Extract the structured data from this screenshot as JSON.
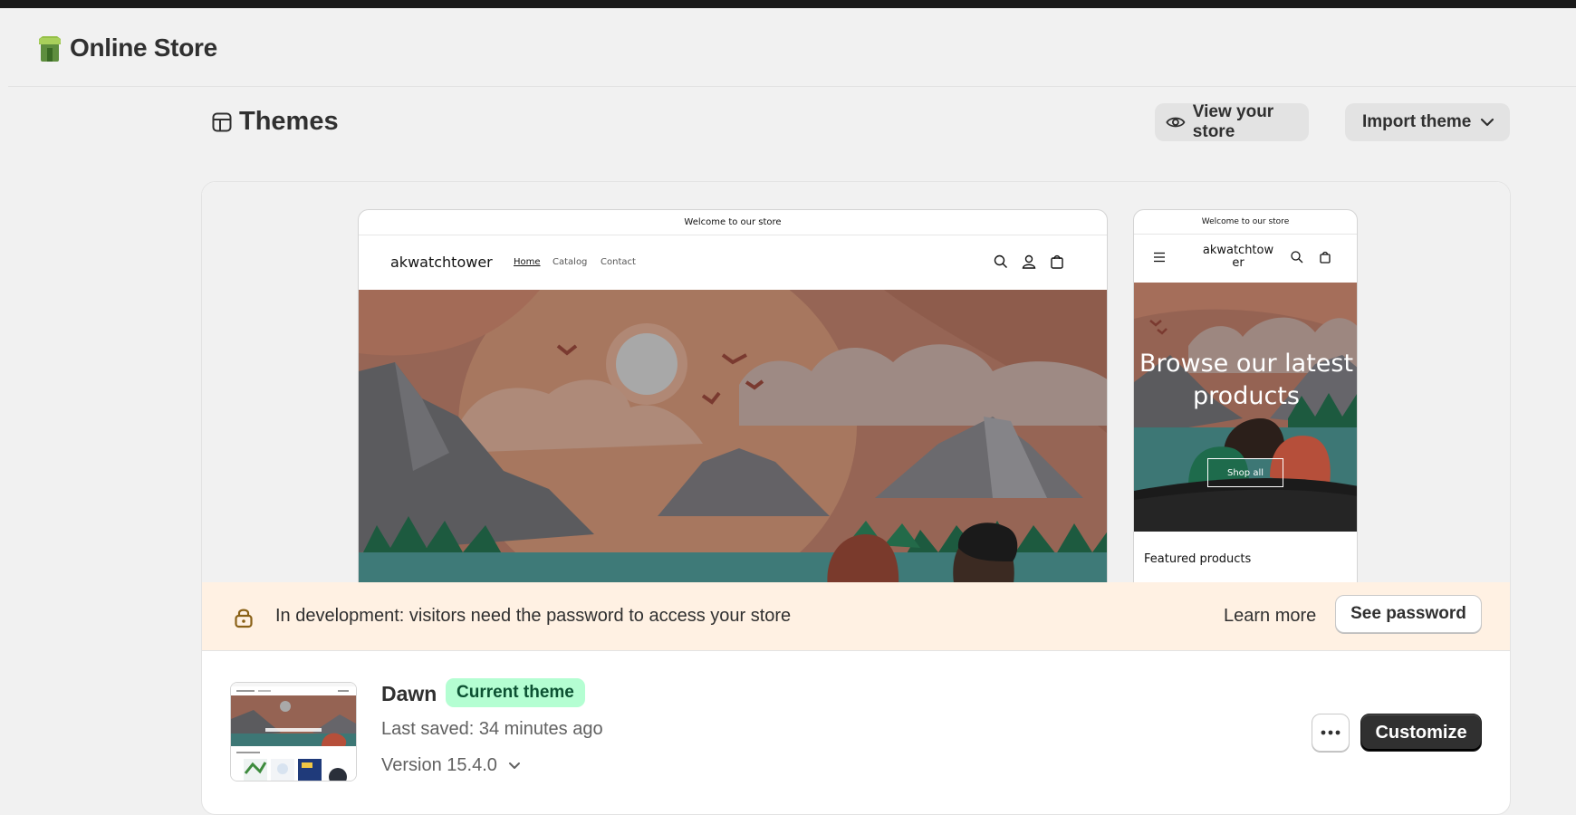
{
  "app": {
    "title": "Online Store"
  },
  "page": {
    "title": "Themes",
    "view_store_label": "View your store",
    "import_theme_label": "Import theme"
  },
  "desktop_preview": {
    "announcement": "Welcome to our store",
    "brand": "akwatchtower",
    "nav": [
      "Home",
      "Catalog",
      "Contact"
    ]
  },
  "mobile_preview": {
    "announcement": "Welcome to our store",
    "brand": "akwatchtower",
    "hero_title": "Browse our latest products",
    "shop_all": "Shop all",
    "featured": "Featured products"
  },
  "banner": {
    "message": "In development: visitors need the password to access your store",
    "learn_more": "Learn more",
    "see_password": "See password"
  },
  "theme": {
    "name": "Dawn",
    "badge": "Current theme",
    "last_saved": "Last saved: 34 minutes ago",
    "version": "Version 15.4.0",
    "customize_label": "Customize"
  },
  "colors": {
    "badge_bg": "#b4fed2",
    "banner_bg": "#fff1e3",
    "primary_button": "#303030"
  },
  "icons": {
    "app": "online-store-icon",
    "themes": "theme-template-icon",
    "view": "eye-icon",
    "import_caret": "chevron-down-icon",
    "banner": "lock-icon",
    "more": "ellipsis-icon"
  }
}
